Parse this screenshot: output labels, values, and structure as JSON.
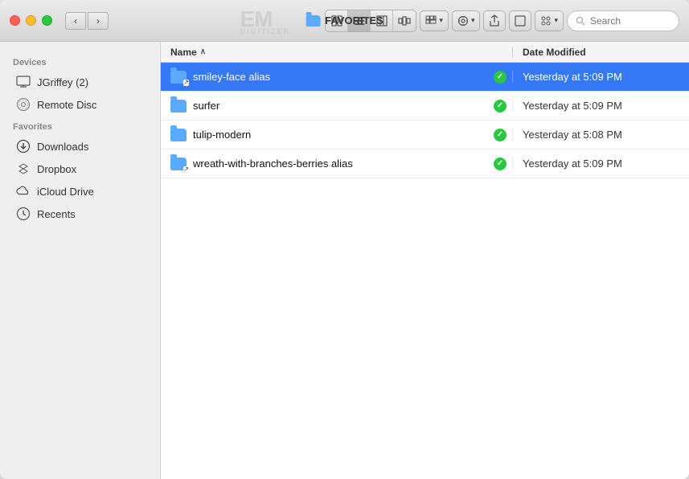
{
  "window": {
    "title": "FAVORITES"
  },
  "traffic_lights": {
    "red": "close",
    "yellow": "minimize",
    "green": "maximize"
  },
  "logo": {
    "em": "EM",
    "sub": "DIGITIZER"
  },
  "toolbar": {
    "view_icons_label": "⊞",
    "view_list_label": "≡",
    "view_columns_label": "⊟",
    "view_cover_label": "⊠",
    "view_gallery_label": "⊟",
    "action_label": "⚙",
    "share_label": "⎙",
    "tag_label": "◻",
    "arrange_label": "❖",
    "search_placeholder": "Search"
  },
  "sidebar": {
    "devices_label": "Devices",
    "favorites_label": "Favorites",
    "items": [
      {
        "id": "jgriffey",
        "icon": "monitor",
        "label": "JGriffey (2)"
      },
      {
        "id": "remote-disc",
        "icon": "disc",
        "label": "Remote Disc"
      },
      {
        "id": "downloads",
        "icon": "downloads",
        "label": "Downloads"
      },
      {
        "id": "dropbox",
        "icon": "dropbox",
        "label": "Dropbox"
      },
      {
        "id": "icloud",
        "icon": "icloud",
        "label": "iCloud Drive"
      },
      {
        "id": "recents",
        "icon": "recents",
        "label": "Recents"
      }
    ]
  },
  "file_list": {
    "col_name": "Name",
    "col_date": "Date Modified",
    "sort_col": "name",
    "sort_dir": "asc",
    "files": [
      {
        "id": "smiley-face-alias",
        "name": "smiley-face alias",
        "is_alias": true,
        "status": "synced",
        "date": "Yesterday at 5:09 PM",
        "selected": true
      },
      {
        "id": "surfer",
        "name": "surfer",
        "is_alias": false,
        "status": "synced",
        "date": "Yesterday at 5:09 PM",
        "selected": false
      },
      {
        "id": "tulip-modern",
        "name": "tulip-modern",
        "is_alias": false,
        "status": "synced",
        "date": "Yesterday at 5:08 PM",
        "selected": false
      },
      {
        "id": "wreath-alias",
        "name": "wreath-with-branches-berries alias",
        "is_alias": true,
        "status": "synced",
        "date": "Yesterday at 5:09 PM",
        "selected": false
      }
    ]
  }
}
